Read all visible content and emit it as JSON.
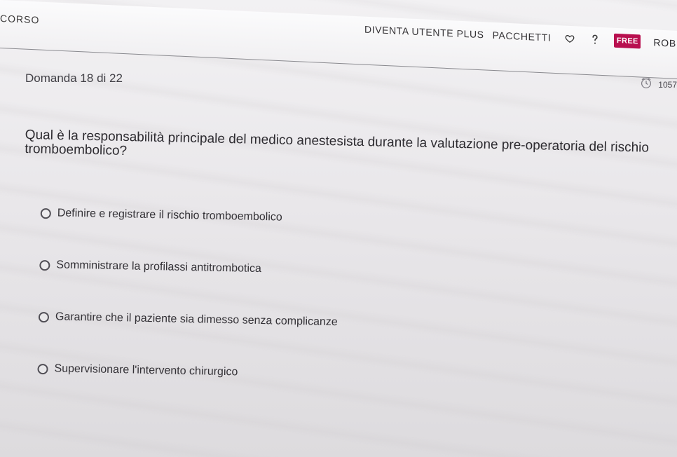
{
  "header": {
    "brand_fragment": "CORSO",
    "nav_items": [
      {
        "label": "DIVENTA UTENTE PLUS"
      },
      {
        "label": "PACCHETTI"
      }
    ],
    "badge": "FREE",
    "profile_fragment": "ROB",
    "icons": [
      "heart-icon",
      "help-icon"
    ]
  },
  "quiz": {
    "progress_text": "Domanda 18 di 22",
    "timer": "1057",
    "question": "Qual è la responsabilità principale del medico anestesista durante la valutazione pre-operatoria del rischio tromboembolico?",
    "options": [
      "Definire e registrare il rischio tromboembolico",
      "Somministrare la profilassi antitrombotica",
      "Garantire che il paziente sia dimesso senza complicanze",
      "Supervisionare l'intervento chirurgico"
    ]
  },
  "colors": {
    "accent": "#b80f4f",
    "background": "#ebe9ec",
    "text": "#3a3838"
  }
}
